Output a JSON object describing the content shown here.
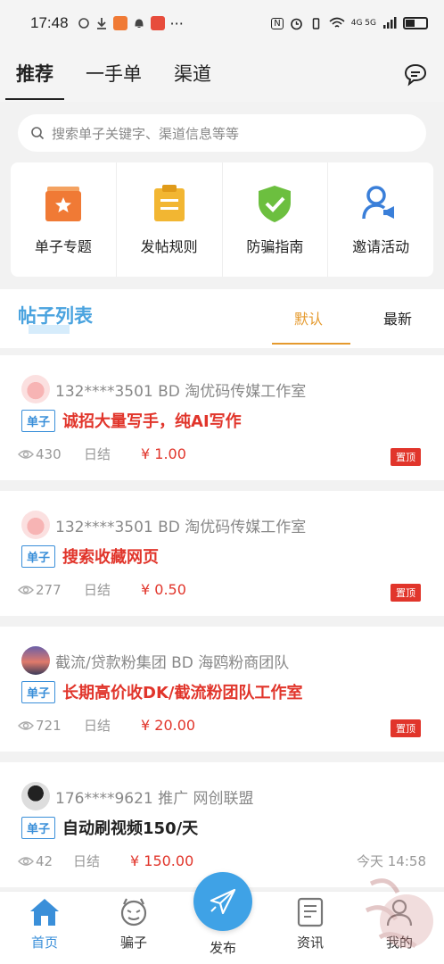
{
  "status_bar": {
    "time": "17:48",
    "more": "···",
    "network": "4G 5G"
  },
  "header": {
    "tabs": [
      {
        "label": "推荐",
        "active": true
      },
      {
        "label": "一手单",
        "active": false
      },
      {
        "label": "渠道",
        "active": false
      }
    ]
  },
  "search": {
    "placeholder": "搜索单子关键字、渠道信息等等"
  },
  "quick_menu": [
    {
      "label": "单子专题",
      "icon": "star-folder-icon",
      "color": "#f07a35"
    },
    {
      "label": "发帖规则",
      "icon": "clipboard-icon",
      "color": "#f2b632"
    },
    {
      "label": "防骗指南",
      "icon": "shield-check-icon",
      "color": "#6cbf3f"
    },
    {
      "label": "邀请活动",
      "icon": "user-megaphone-icon",
      "color": "#3a7fd9"
    }
  ],
  "list": {
    "title": "帖子列表",
    "sort_default": "默认",
    "sort_latest": "最新"
  },
  "posts": [
    {
      "author": "132****3501 BD 淘优码传媒工作室",
      "tag": "单子",
      "title": "诚招大量写手，纯AI写作",
      "views": "430",
      "settle": "日结",
      "price": "¥ 1.00",
      "pin": "置顶"
    },
    {
      "author": "132****3501 BD 淘优码传媒工作室",
      "tag": "单子",
      "title": "搜索收藏网页",
      "views": "277",
      "settle": "日结",
      "price": "¥ 0.50",
      "pin": "置顶"
    },
    {
      "author": "截流/贷款粉集团 BD 海鸥粉商团队",
      "tag": "单子",
      "title": "长期高价收DK/截流粉团队工作室",
      "views": "721",
      "settle": "日结",
      "price": "¥ 20.00",
      "pin": "置顶"
    },
    {
      "author": "176****9621 推广 网创联盟",
      "tag": "单子",
      "title": "自动刷视频150/天",
      "views": "42",
      "settle": "日结",
      "price": "¥ 150.00",
      "time": "今天 14:58"
    }
  ],
  "bottom_nav": [
    {
      "label": "首页",
      "icon": "home-icon",
      "active": true
    },
    {
      "label": "骗子",
      "icon": "devil-face-icon",
      "active": false
    },
    {
      "label": "发布",
      "icon": "paper-plane-icon",
      "active": false
    },
    {
      "label": "资讯",
      "icon": "news-icon",
      "active": false
    },
    {
      "label": "我的",
      "icon": "user-icon",
      "active": false
    }
  ],
  "colors": {
    "accent": "#3a8fd9",
    "price_red": "#e1352b",
    "sort_orange": "#e59a2e"
  }
}
